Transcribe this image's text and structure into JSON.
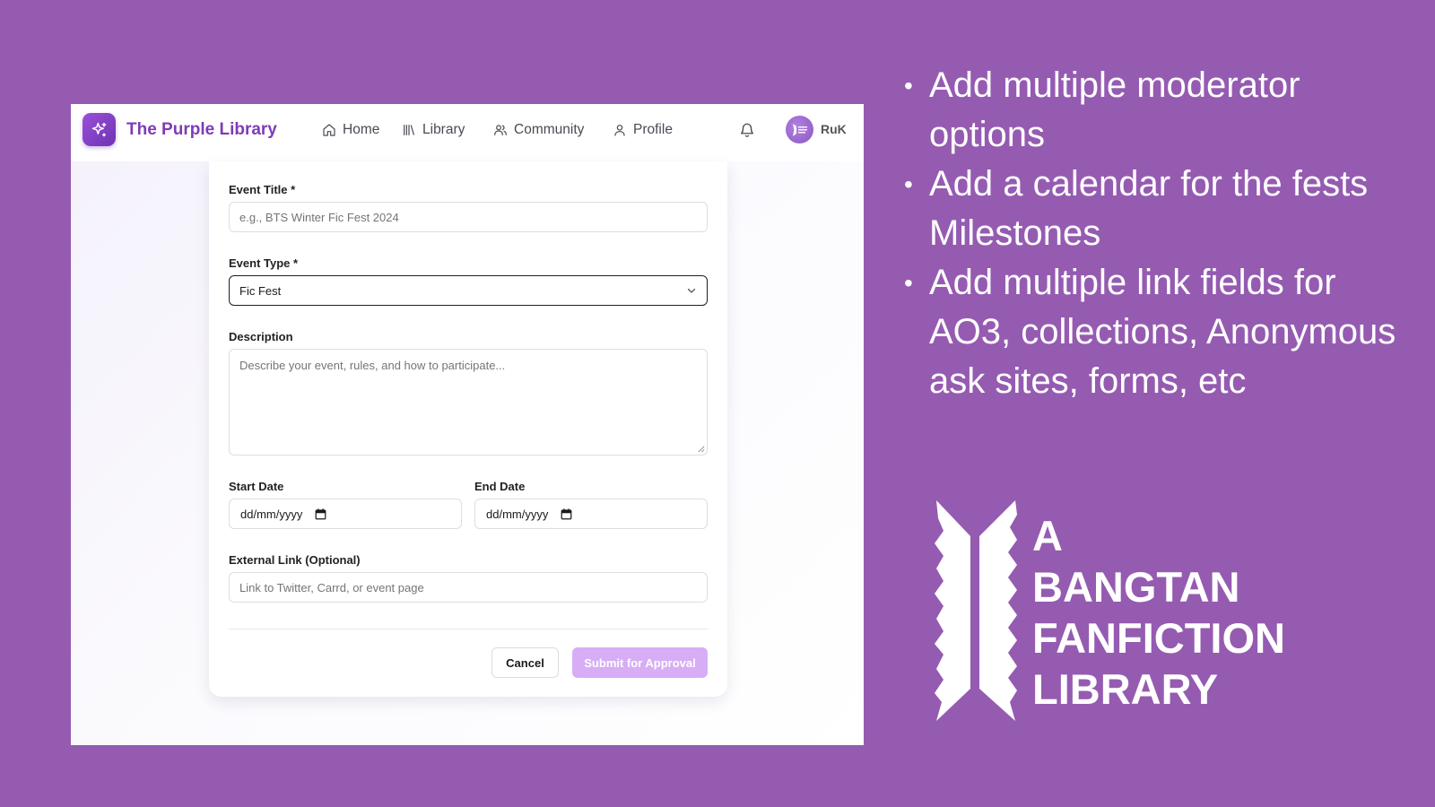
{
  "navbar": {
    "brand": "The Purple Library",
    "items": [
      {
        "label": "Home",
        "icon": "home-icon"
      },
      {
        "label": "Library",
        "icon": "library-icon"
      },
      {
        "label": "Community",
        "icon": "users-icon"
      },
      {
        "label": "Profile",
        "icon": "user-icon"
      }
    ],
    "notification_icon": "bell-icon",
    "username": "RuK"
  },
  "form": {
    "event_title": {
      "label": "Event Title *",
      "placeholder": "e.g., BTS Winter Fic Fest 2024"
    },
    "event_type": {
      "label": "Event Type *",
      "value": "Fic Fest"
    },
    "description": {
      "label": "Description",
      "placeholder": "Describe your event, rules, and how to participate..."
    },
    "start_date": {
      "label": "Start Date",
      "value": "dd/mm/yyyy"
    },
    "end_date": {
      "label": "End Date",
      "value": "dd/mm/yyyy"
    },
    "external_link": {
      "label": "External Link (Optional)",
      "placeholder": "Link to Twitter, Carrd, or event page"
    },
    "cancel_label": "Cancel",
    "submit_label": "Submit for Approval"
  },
  "notes": [
    "Add multiple moderator options",
    "Add a calendar for the fests Milestones",
    "Add multiple link fields for AO3, collections, Anonymous ask sites, forms, etc"
  ],
  "logo": {
    "line1": "A",
    "line2": "BANGTAN",
    "line3": "FANFICTION",
    "line4": "LIBRARY"
  },
  "colors": {
    "background": "#955bb1",
    "brand": "#7e3bb6",
    "submit_button": "#d7aef5"
  }
}
